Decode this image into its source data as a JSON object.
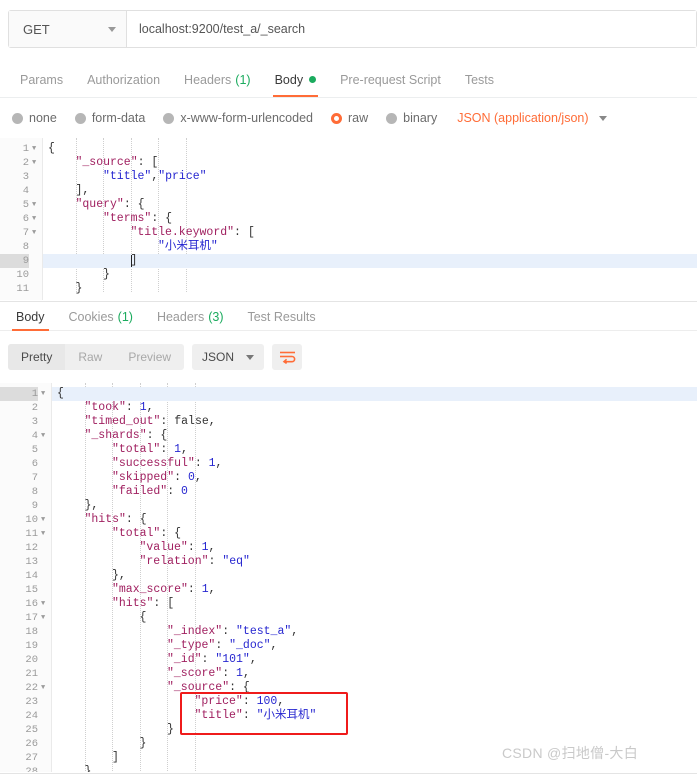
{
  "request": {
    "method": "GET",
    "url": "localhost:9200/test_a/_search",
    "tabs": [
      {
        "label": "Params",
        "count": "",
        "active": false,
        "dot": false
      },
      {
        "label": "Authorization",
        "count": "",
        "active": false,
        "dot": false
      },
      {
        "label": "Headers",
        "count": "(1)",
        "active": false,
        "dot": false
      },
      {
        "label": "Body",
        "count": "",
        "active": true,
        "dot": true
      },
      {
        "label": "Pre-request Script",
        "count": "",
        "active": false,
        "dot": false
      },
      {
        "label": "Tests",
        "count": "",
        "active": false,
        "dot": false
      }
    ],
    "body_types": [
      {
        "label": "none",
        "selected": false
      },
      {
        "label": "form-data",
        "selected": false
      },
      {
        "label": "x-www-form-urlencoded",
        "selected": false
      },
      {
        "label": "raw",
        "selected": true
      },
      {
        "label": "binary",
        "selected": false
      }
    ],
    "content_type": "JSON (application/json)",
    "editor": {
      "active_line": 9,
      "lines": [
        {
          "num": "1",
          "fold": true,
          "indent": 0,
          "tokens": [
            {
              "t": "{",
              "c": "p"
            }
          ]
        },
        {
          "num": "2",
          "fold": true,
          "indent": 1,
          "tokens": [
            {
              "t": "\"_source\"",
              "c": "k"
            },
            {
              "t": ": [",
              "c": "p"
            }
          ]
        },
        {
          "num": "3",
          "fold": false,
          "indent": 2,
          "tokens": [
            {
              "t": "\"title\"",
              "c": "s"
            },
            {
              "t": ",",
              "c": "p"
            },
            {
              "t": "\"price\"",
              "c": "s"
            }
          ]
        },
        {
          "num": "4",
          "fold": false,
          "indent": 1,
          "tokens": [
            {
              "t": "],",
              "c": "p"
            }
          ]
        },
        {
          "num": "5",
          "fold": true,
          "indent": 1,
          "tokens": [
            {
              "t": "\"query\"",
              "c": "k"
            },
            {
              "t": ": {",
              "c": "p"
            }
          ]
        },
        {
          "num": "6",
          "fold": true,
          "indent": 2,
          "tokens": [
            {
              "t": "\"terms\"",
              "c": "k"
            },
            {
              "t": ": {",
              "c": "p"
            }
          ]
        },
        {
          "num": "7",
          "fold": true,
          "indent": 3,
          "tokens": [
            {
              "t": "\"title.keyword\"",
              "c": "k"
            },
            {
              "t": ": [",
              "c": "p"
            }
          ]
        },
        {
          "num": "8",
          "fold": false,
          "indent": 4,
          "tokens": [
            {
              "t": "\"小米耳机\"",
              "c": "s"
            }
          ]
        },
        {
          "num": "9",
          "fold": false,
          "indent": 3,
          "tokens": [
            {
              "t": "]",
              "c": "p"
            }
          ]
        },
        {
          "num": "10",
          "fold": false,
          "indent": 2,
          "tokens": [
            {
              "t": "}",
              "c": "p"
            }
          ]
        },
        {
          "num": "11",
          "fold": false,
          "indent": 1,
          "tokens": [
            {
              "t": "}",
              "c": "p"
            }
          ]
        }
      ]
    }
  },
  "response": {
    "tabs": [
      {
        "label": "Body",
        "count": "",
        "active": true
      },
      {
        "label": "Cookies",
        "count": "(1)",
        "active": false
      },
      {
        "label": "Headers",
        "count": "(3)",
        "active": false
      },
      {
        "label": "Test Results",
        "count": "",
        "active": false
      }
    ],
    "view_modes": [
      {
        "label": "Pretty",
        "active": true
      },
      {
        "label": "Raw",
        "active": false
      },
      {
        "label": "Preview",
        "active": false
      }
    ],
    "format": "JSON",
    "editor": {
      "active_line": 1,
      "lines": [
        {
          "num": "1",
          "fold": true,
          "indent": 0,
          "tokens": [
            {
              "t": "{",
              "c": "p"
            }
          ]
        },
        {
          "num": "2",
          "fold": false,
          "indent": 1,
          "tokens": [
            {
              "t": "\"took\"",
              "c": "k"
            },
            {
              "t": ": ",
              "c": "p"
            },
            {
              "t": "1",
              "c": "n"
            },
            {
              "t": ",",
              "c": "p"
            }
          ]
        },
        {
          "num": "3",
          "fold": false,
          "indent": 1,
          "tokens": [
            {
              "t": "\"timed_out\"",
              "c": "k"
            },
            {
              "t": ": ",
              "c": "p"
            },
            {
              "t": "false",
              "c": "b"
            },
            {
              "t": ",",
              "c": "p"
            }
          ]
        },
        {
          "num": "4",
          "fold": true,
          "indent": 1,
          "tokens": [
            {
              "t": "\"_shards\"",
              "c": "k"
            },
            {
              "t": ": {",
              "c": "p"
            }
          ]
        },
        {
          "num": "5",
          "fold": false,
          "indent": 2,
          "tokens": [
            {
              "t": "\"total\"",
              "c": "k"
            },
            {
              "t": ": ",
              "c": "p"
            },
            {
              "t": "1",
              "c": "n"
            },
            {
              "t": ",",
              "c": "p"
            }
          ]
        },
        {
          "num": "6",
          "fold": false,
          "indent": 2,
          "tokens": [
            {
              "t": "\"successful\"",
              "c": "k"
            },
            {
              "t": ": ",
              "c": "p"
            },
            {
              "t": "1",
              "c": "n"
            },
            {
              "t": ",",
              "c": "p"
            }
          ]
        },
        {
          "num": "7",
          "fold": false,
          "indent": 2,
          "tokens": [
            {
              "t": "\"skipped\"",
              "c": "k"
            },
            {
              "t": ": ",
              "c": "p"
            },
            {
              "t": "0",
              "c": "n"
            },
            {
              "t": ",",
              "c": "p"
            }
          ]
        },
        {
          "num": "8",
          "fold": false,
          "indent": 2,
          "tokens": [
            {
              "t": "\"failed\"",
              "c": "k"
            },
            {
              "t": ": ",
              "c": "p"
            },
            {
              "t": "0",
              "c": "n"
            }
          ]
        },
        {
          "num": "9",
          "fold": false,
          "indent": 1,
          "tokens": [
            {
              "t": "},",
              "c": "p"
            }
          ]
        },
        {
          "num": "10",
          "fold": true,
          "indent": 1,
          "tokens": [
            {
              "t": "\"hits\"",
              "c": "k"
            },
            {
              "t": ": {",
              "c": "p"
            }
          ]
        },
        {
          "num": "11",
          "fold": true,
          "indent": 2,
          "tokens": [
            {
              "t": "\"total\"",
              "c": "k"
            },
            {
              "t": ": {",
              "c": "p"
            }
          ]
        },
        {
          "num": "12",
          "fold": false,
          "indent": 3,
          "tokens": [
            {
              "t": "\"value\"",
              "c": "k"
            },
            {
              "t": ": ",
              "c": "p"
            },
            {
              "t": "1",
              "c": "n"
            },
            {
              "t": ",",
              "c": "p"
            }
          ]
        },
        {
          "num": "13",
          "fold": false,
          "indent": 3,
          "tokens": [
            {
              "t": "\"relation\"",
              "c": "k"
            },
            {
              "t": ": ",
              "c": "p"
            },
            {
              "t": "\"eq\"",
              "c": "s"
            }
          ]
        },
        {
          "num": "14",
          "fold": false,
          "indent": 2,
          "tokens": [
            {
              "t": "},",
              "c": "p"
            }
          ]
        },
        {
          "num": "15",
          "fold": false,
          "indent": 2,
          "tokens": [
            {
              "t": "\"max_score\"",
              "c": "k"
            },
            {
              "t": ": ",
              "c": "p"
            },
            {
              "t": "1",
              "c": "n"
            },
            {
              "t": ",",
              "c": "p"
            }
          ]
        },
        {
          "num": "16",
          "fold": true,
          "indent": 2,
          "tokens": [
            {
              "t": "\"hits\"",
              "c": "k"
            },
            {
              "t": ": [",
              "c": "p"
            }
          ]
        },
        {
          "num": "17",
          "fold": true,
          "indent": 3,
          "tokens": [
            {
              "t": "{",
              "c": "p"
            }
          ]
        },
        {
          "num": "18",
          "fold": false,
          "indent": 4,
          "tokens": [
            {
              "t": "\"_index\"",
              "c": "k"
            },
            {
              "t": ": ",
              "c": "p"
            },
            {
              "t": "\"test_a\"",
              "c": "s"
            },
            {
              "t": ",",
              "c": "p"
            }
          ]
        },
        {
          "num": "19",
          "fold": false,
          "indent": 4,
          "tokens": [
            {
              "t": "\"_type\"",
              "c": "k"
            },
            {
              "t": ": ",
              "c": "p"
            },
            {
              "t": "\"_doc\"",
              "c": "s"
            },
            {
              "t": ",",
              "c": "p"
            }
          ]
        },
        {
          "num": "20",
          "fold": false,
          "indent": 4,
          "tokens": [
            {
              "t": "\"_id\"",
              "c": "k"
            },
            {
              "t": ": ",
              "c": "p"
            },
            {
              "t": "\"101\"",
              "c": "s"
            },
            {
              "t": ",",
              "c": "p"
            }
          ]
        },
        {
          "num": "21",
          "fold": false,
          "indent": 4,
          "tokens": [
            {
              "t": "\"_score\"",
              "c": "k"
            },
            {
              "t": ": ",
              "c": "p"
            },
            {
              "t": "1",
              "c": "n"
            },
            {
              "t": ",",
              "c": "p"
            }
          ]
        },
        {
          "num": "22",
          "fold": true,
          "indent": 4,
          "tokens": [
            {
              "t": "\"_source\"",
              "c": "k"
            },
            {
              "t": ": {",
              "c": "p"
            }
          ]
        },
        {
          "num": "23",
          "fold": false,
          "indent": 5,
          "tokens": [
            {
              "t": "\"price\"",
              "c": "k"
            },
            {
              "t": ": ",
              "c": "p"
            },
            {
              "t": "100",
              "c": "n"
            },
            {
              "t": ",",
              "c": "p"
            }
          ]
        },
        {
          "num": "24",
          "fold": false,
          "indent": 5,
          "tokens": [
            {
              "t": "\"title\"",
              "c": "k"
            },
            {
              "t": ": ",
              "c": "p"
            },
            {
              "t": "\"小米耳机\"",
              "c": "s"
            }
          ]
        },
        {
          "num": "25",
          "fold": false,
          "indent": 4,
          "tokens": [
            {
              "t": "}",
              "c": "p"
            }
          ]
        },
        {
          "num": "26",
          "fold": false,
          "indent": 3,
          "tokens": [
            {
              "t": "}",
              "c": "p"
            }
          ]
        },
        {
          "num": "27",
          "fold": false,
          "indent": 2,
          "tokens": [
            {
              "t": "]",
              "c": "p"
            }
          ]
        },
        {
          "num": "28",
          "fold": false,
          "indent": 1,
          "tokens": [
            {
              "t": "}",
              "c": "p"
            }
          ]
        }
      ]
    },
    "highlight_box": {
      "label": "source-fields-highlight",
      "color": "#ef1b1b"
    }
  },
  "watermark": "CSDN @扫地僧-大白",
  "colors": {
    "accent": "#ff6c37",
    "green": "#1bab5e",
    "highlight": "#ef1b1b",
    "key": "#a02060",
    "string": "#2727d0"
  }
}
